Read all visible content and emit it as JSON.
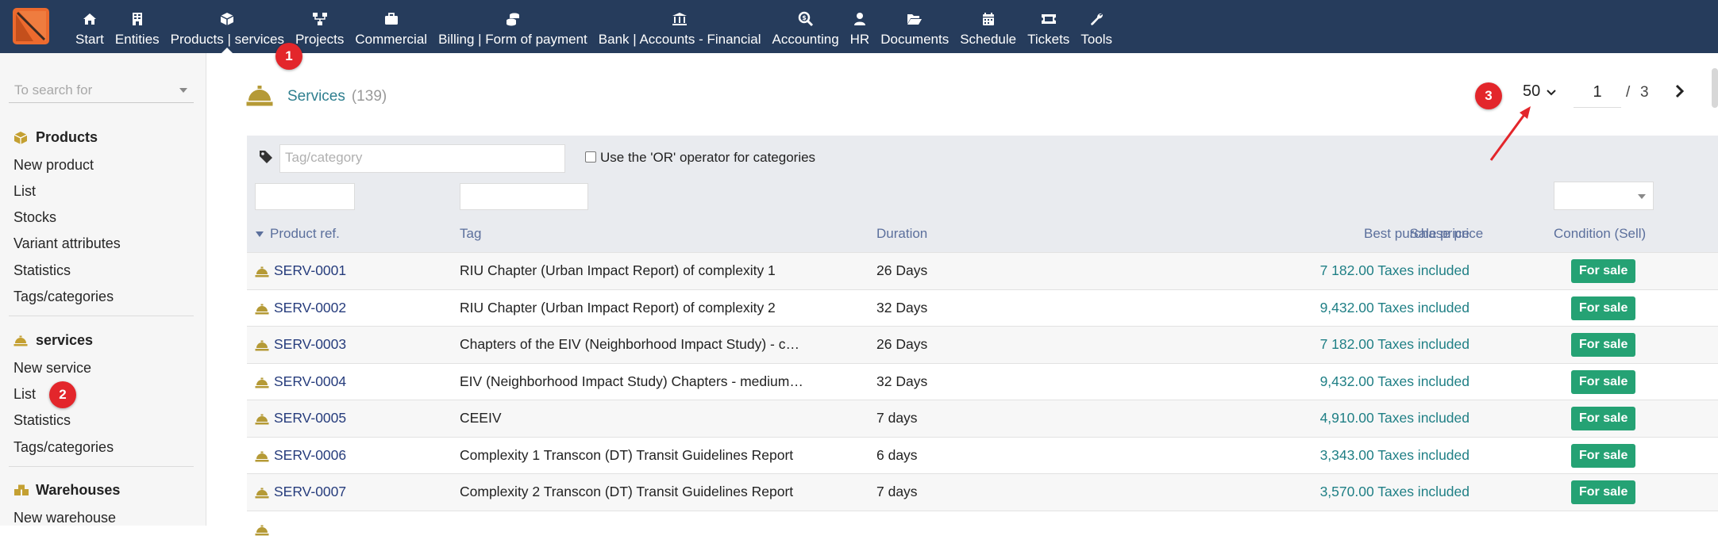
{
  "colors": {
    "topbar": "#263c5c",
    "accent": "#ec6a2e",
    "link": "#2f7f8f",
    "status_green": "#25a274",
    "badge_red": "#e3262b"
  },
  "menu": [
    {
      "label": "Start",
      "icon": "home-icon"
    },
    {
      "label": "Entities",
      "icon": "building-icon"
    },
    {
      "label": "Products | services",
      "icon": "cube-icon"
    },
    {
      "label": "Projects",
      "icon": "sitemap-icon"
    },
    {
      "label": "Commercial",
      "icon": "briefcase-icon"
    },
    {
      "label": "Billing | Form of payment",
      "icon": "coins-icon"
    },
    {
      "label": "Bank | Accounts - Financial",
      "icon": "bank-icon"
    },
    {
      "label": "Accounting",
      "icon": "search-dollar-icon"
    },
    {
      "label": "HR",
      "icon": "user-icon"
    },
    {
      "label": "Documents",
      "icon": "folder-open-icon"
    },
    {
      "label": "Schedule",
      "icon": "calendar-icon"
    },
    {
      "label": "Tickets",
      "icon": "ticket-icon"
    },
    {
      "label": "Tools",
      "icon": "wrench-icon"
    }
  ],
  "sidebar": {
    "search_placeholder": "To search for",
    "products": {
      "title": "Products",
      "items": [
        "New product",
        "List",
        "Stocks",
        "Variant attributes",
        "Statistics",
        "Tags/categories"
      ]
    },
    "services": {
      "title": "services",
      "items": [
        "New service",
        "List",
        "Statistics",
        "Tags/categories"
      ]
    },
    "warehouses": {
      "title": "Warehouses",
      "items": [
        "New warehouse"
      ]
    }
  },
  "badges": [
    "1",
    "2",
    "3"
  ],
  "page": {
    "title": "Services",
    "count": "(139)",
    "per_page": "50",
    "current_page": "1",
    "slash": "/",
    "total_pages": "3"
  },
  "filters": {
    "tag_placeholder": "Tag/category",
    "or_label": "Use the 'OR' operator for categories"
  },
  "columns": {
    "ref": "Product ref.",
    "tag": "Tag",
    "duration": "Duration",
    "sale_price": "Sale price",
    "best_purchase": "Best purchase price",
    "condition": "Condition (Sell)"
  },
  "rows": [
    {
      "ref": "SERV-0001",
      "tag": "RIU Chapter (Urban Impact Report) of complexity 1",
      "duration": "26 Days",
      "price": "7 182.00 Taxes included",
      "status": "For sale"
    },
    {
      "ref": "SERV-0002",
      "tag": "RIU Chapter (Urban Impact Report) of complexity 2",
      "duration": "32 Days",
      "price": "9,432.00 Taxes included",
      "status": "For sale"
    },
    {
      "ref": "SERV-0003",
      "tag": "Chapters of the EIV (Neighborhood Impact Study) - c…",
      "duration": "26 Days",
      "price": "7 182.00 Taxes included",
      "status": "For sale"
    },
    {
      "ref": "SERV-0004",
      "tag": "EIV (Neighborhood Impact Study) Chapters - medium…",
      "duration": "32 Days",
      "price": "9,432.00 Taxes included",
      "status": "For sale"
    },
    {
      "ref": "SERV-0005",
      "tag": "CEEIV",
      "duration": " 7 days",
      "price": "4,910.00 Taxes included",
      "status": "For sale"
    },
    {
      "ref": "SERV-0006",
      "tag": "Complexity 1 Transcon (DT) Transit Guidelines Report",
      "duration": " 6 days",
      "price": "3,343.00 Taxes included",
      "status": "For sale"
    },
    {
      "ref": "SERV-0007",
      "tag": "Complexity 2 Transcon (DT) Transit Guidelines Report",
      "duration": " 7 days",
      "price": "3,570.00 Taxes included",
      "status": "For sale"
    }
  ]
}
